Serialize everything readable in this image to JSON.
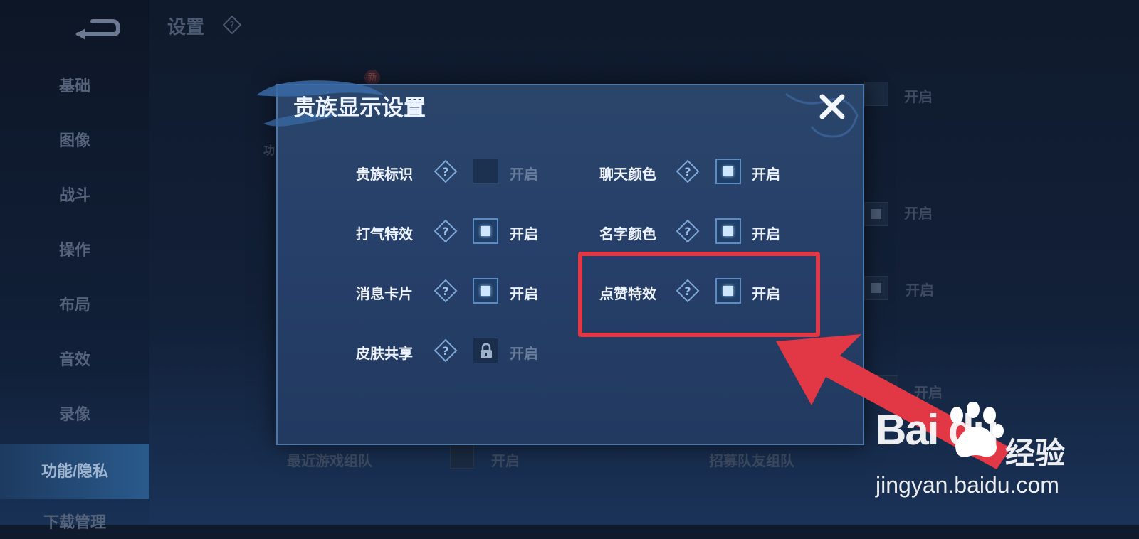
{
  "header": {
    "title": "设置"
  },
  "sidebar": {
    "items": [
      {
        "label": "基础"
      },
      {
        "label": "图像"
      },
      {
        "label": "战斗"
      },
      {
        "label": "操作"
      },
      {
        "label": "布局"
      },
      {
        "label": "音效"
      },
      {
        "label": "录像"
      },
      {
        "label": "功能/隐私",
        "active": true
      },
      {
        "label": "下载管理"
      }
    ]
  },
  "background": {
    "new_badge": "新",
    "tab_partial": "功",
    "right_states": [
      "开启",
      "开启",
      "开启",
      "开启"
    ],
    "bottom_left_label": "最近游戏组队",
    "bottom_left_state": "开启",
    "bottom_right_label": "招募队友组队"
  },
  "dialog": {
    "title": "贵族显示设置",
    "options": [
      {
        "label": "贵族标识",
        "state": "开启",
        "checked": false,
        "locked": false
      },
      {
        "label": "聊天颜色",
        "state": "开启",
        "checked": true,
        "locked": false
      },
      {
        "label": "打气特效",
        "state": "开启",
        "checked": true,
        "locked": false
      },
      {
        "label": "名字颜色",
        "state": "开启",
        "checked": true,
        "locked": false
      },
      {
        "label": "消息卡片",
        "state": "开启",
        "checked": true,
        "locked": false
      },
      {
        "label": "点赞特效",
        "state": "开启",
        "checked": true,
        "locked": false
      },
      {
        "label": "皮肤共享",
        "state": "开启",
        "checked": false,
        "locked": true
      }
    ]
  },
  "watermark": {
    "logo": "Bai du",
    "jingyan": "经验",
    "url": "jingyan.baidu.com"
  },
  "colors": {
    "highlight": "#e23744",
    "accent": "#5b8dc4"
  }
}
